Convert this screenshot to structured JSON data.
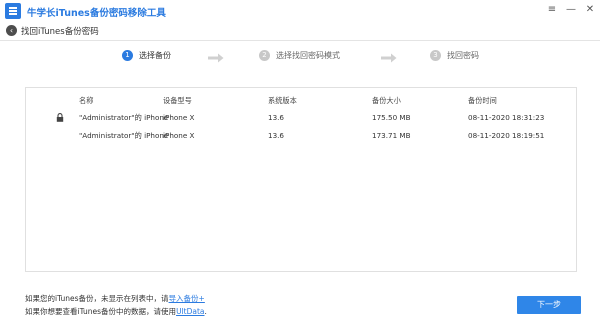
{
  "window": {
    "title": "牛学长iTunes备份密码移除工具",
    "controls": [
      "≡",
      "—",
      "✕"
    ]
  },
  "back": {
    "label": "找回iTunes备份密码"
  },
  "steps": [
    {
      "num": "1",
      "label": "选择备份",
      "state": "active"
    },
    {
      "num": "2",
      "label": "选择找回密码模式",
      "state": "inactive"
    },
    {
      "num": "3",
      "label": "找回密码",
      "state": "inactive"
    }
  ],
  "table": {
    "headers": [
      "名称",
      "设备型号",
      "系统版本",
      "备份大小",
      "备份时间"
    ],
    "rows": [
      {
        "locked": true,
        "name": "\"Administrator\"的 iPhone",
        "model": "iPhone X",
        "version": "13.6",
        "size": "175.50 MB",
        "time": "08-11-2020 18:31:23"
      },
      {
        "locked": false,
        "name": "\"Administrator\"的 iPhone",
        "model": "iPhone X",
        "version": "13.6",
        "size": "173.71 MB",
        "time": "08-11-2020 18:19:51"
      }
    ]
  },
  "footer": {
    "line1_text": "如果您的iTunes备份，未显示在列表中，请",
    "line1_link": "导入备份+",
    "line2_text": "如果你想要查看iTunes备份中的数据，请使用",
    "line2_link": "UltData",
    "line2_end": "."
  },
  "next_button": {
    "label": "下一步"
  },
  "colors": {
    "accent": "#2b7be0",
    "button": "#2f86e8",
    "inactive_step": "#c8c8c8"
  }
}
